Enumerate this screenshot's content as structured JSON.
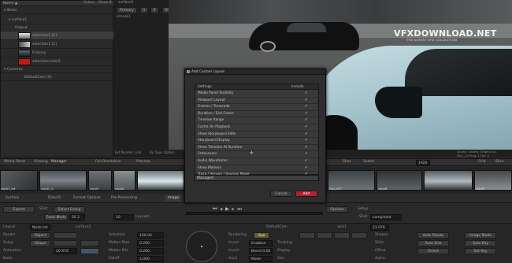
{
  "left_panel": {
    "header_cols": [
      "Name ▲",
      "Active",
      "Mono B"
    ],
    "groups": [
      {
        "label": "Shots"
      },
      {
        "label": "surface1"
      },
      {
        "label": "Output"
      },
      {
        "label": "selection1 [1]"
      },
      {
        "label": "selection1 [1]"
      },
      {
        "label": "Primary"
      },
      {
        "label": "selection/color2"
      },
      {
        "label": "Cameras"
      },
      {
        "label": "DefaultCam [0]"
      }
    ]
  },
  "viewer": {
    "tabs": [
      "surface1",
      "Primary",
      "1",
      "2",
      "Slot 2"
    ],
    "corner_label": "pmask1",
    "watermark_title": "VFXDOWNLOAD.NET",
    "watermark_sub": "THE SAFEST VFX COLLECTION",
    "info_left": [
      "Ext Params: Link",
      "By Type: Option",
      "Sublock: 11"
    ],
    "info_right": [
      "Source: Gallery: Original Src",
      "Slot: 1/3 Prog: 1 Fps: 0"
    ]
  },
  "dialog": {
    "title": "Add Custom Layout",
    "col_settings": "Settings",
    "col_include": "Include",
    "items": [
      "Media Panel Visibility",
      "Viewport Layout",
      "Frames / Timecode",
      "Duration / End Frame",
      "Timeline Range",
      "Cache On Playback",
      "Show Storyboard Edits",
      "Storyboard Display",
      "Show Timeline At Runtime",
      "FadeLevers",
      "Audio Waveforms",
      "Show Markers",
      "Track / Version / Sources Mode"
    ],
    "name_value": "Manager|",
    "cancel_label": "Cancel",
    "add_label": "Add",
    "add_color": "#b5202b"
  },
  "media_bar": {
    "items": [
      "Media Panel",
      "Viewing",
      "Manager",
      "Full Resolution",
      "Preview"
    ],
    "right_items": [
      "Shot",
      "Select",
      "1920",
      "Grid",
      "Slice"
    ],
    "thumbs": [
      "clip01_mt",
      "clip02_b",
      "clip03",
      "clip04",
      "clip05",
      "clip06",
      "clip_007",
      "clip08",
      "clip09"
    ]
  },
  "transport": {
    "left": [
      "Export",
      "Shot",
      "Select Group",
      "Track Mode",
      "SS 2"
    ],
    "right": [
      "Options",
      "Setup",
      "Shot",
      "comp/shot"
    ],
    "frame": "10",
    "layout_label": "Layouts",
    "tabs": [
      "Surface",
      "Direct1",
      "Format Options",
      "Pre-Processing",
      "Image"
    ],
    "right_tabs": [
      "Source",
      "Properties",
      "Settings"
    ]
  },
  "bottom": {
    "left_labels": [
      "Layout",
      "Render",
      "Setup",
      "Animation",
      "Node"
    ],
    "left_fields": [
      "Node list",
      "Object",
      "Shape",
      "20 XYZ",
      ""
    ],
    "mid_labels": [
      "Selection",
      "Motion Max",
      "Motion Min",
      "Falloff"
    ],
    "mid_values": [
      "100.00",
      "0.200",
      "0.200",
      "1.000"
    ],
    "surface_label": "surface1",
    "track_labels": [
      "Rendering",
      "Invert",
      "Invert",
      "Aux1"
    ],
    "track_values": [
      "Aux",
      "Enabled",
      "Blend 0.00",
      "Mode"
    ],
    "track_mid": [
      "Tracking",
      "Display",
      "Slot"
    ],
    "right_labels": [
      "Shapes",
      "Slide",
      "Offset",
      "Alpha"
    ],
    "right_cols": [
      "Auto Rotate",
      "Image Mode",
      "Auto Size",
      "Auto Key",
      "Orient",
      "Set Key"
    ],
    "camera_label": "DefaultCam",
    "aux_label": "axis1",
    "fps": "23.976"
  }
}
